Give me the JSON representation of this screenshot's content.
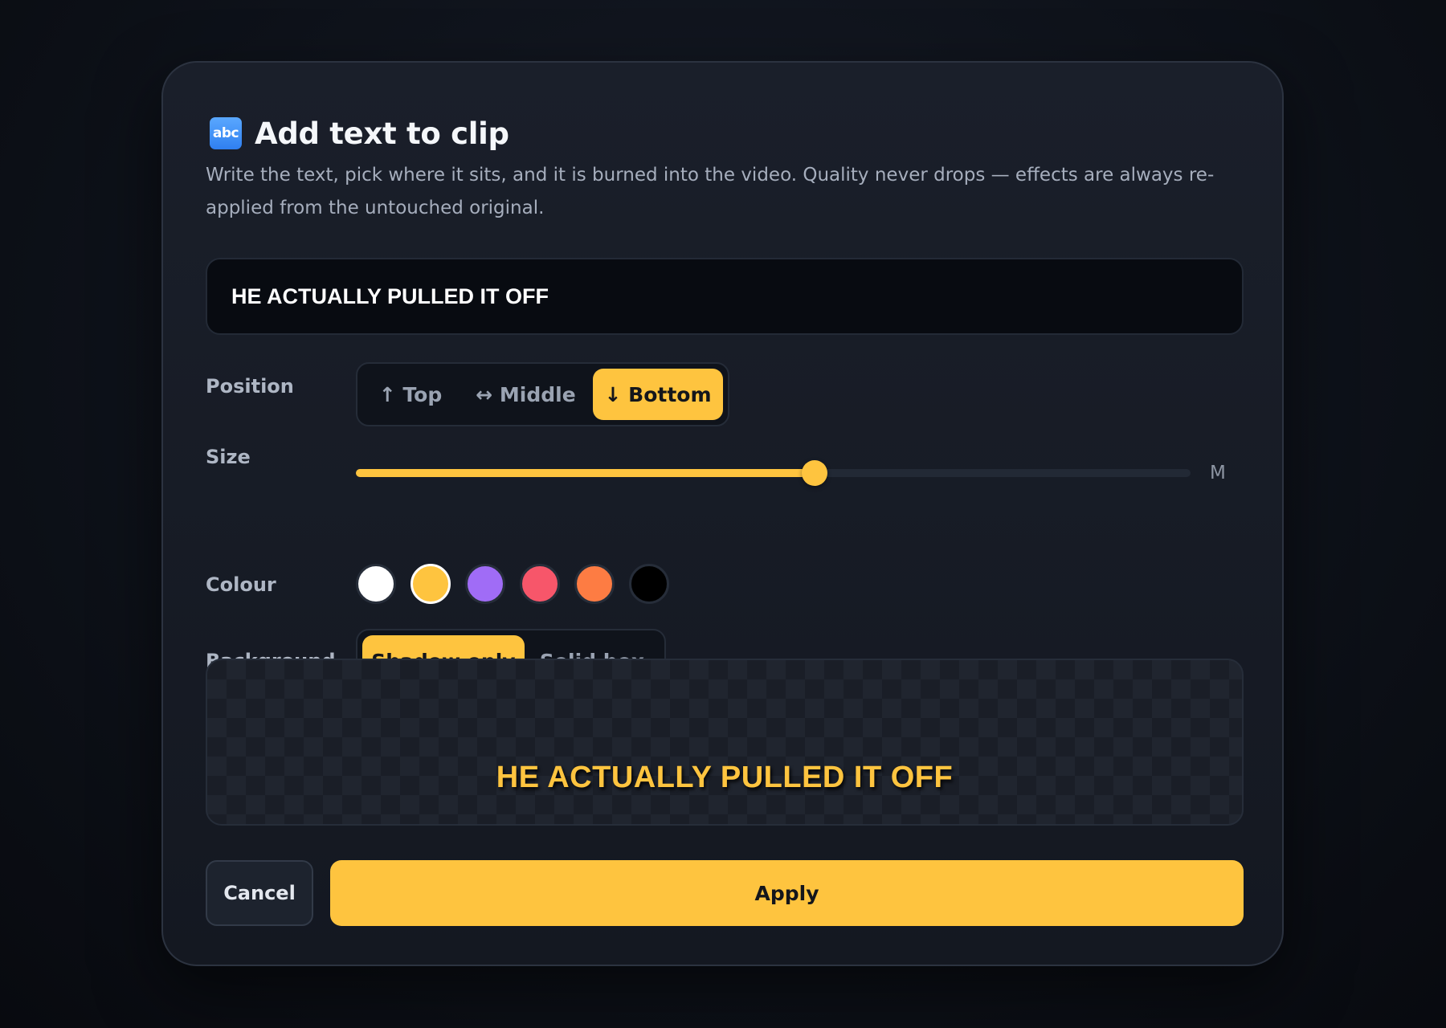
{
  "dialog": {
    "icon": "abc-icon",
    "icon_text": "abc",
    "title": "Add text to clip",
    "description": "Write the text, pick where it sits, and it is burned into the video. Quality never drops — effects are always re-applied from the untouched original."
  },
  "text_input": {
    "value": "HE ACTUALLY PULLED IT OFF"
  },
  "position": {
    "label": "Position",
    "options": [
      "↑ Top",
      "↔ Middle",
      "↓ Bottom"
    ],
    "selected": "↓ Bottom"
  },
  "size": {
    "label": "Size",
    "value_label": "M",
    "level_fraction": 0.55
  },
  "colour": {
    "label": "Colour",
    "swatches": [
      "#ffffff",
      "#fec43f",
      "#a06cf6",
      "#f7566a",
      "#fd7c43",
      "#000000"
    ],
    "selected": "#fec43f"
  },
  "background": {
    "label": "Background",
    "options": [
      "Shadow only",
      "Solid box"
    ],
    "selected": "Shadow only"
  },
  "preview": {
    "text": "HE ACTUALLY PULLED IT OFF",
    "text_color": "#fec43f"
  },
  "actions": {
    "cancel_label": "Cancel",
    "apply_label": "Apply"
  },
  "theme": {
    "accent": "#fec43f"
  }
}
